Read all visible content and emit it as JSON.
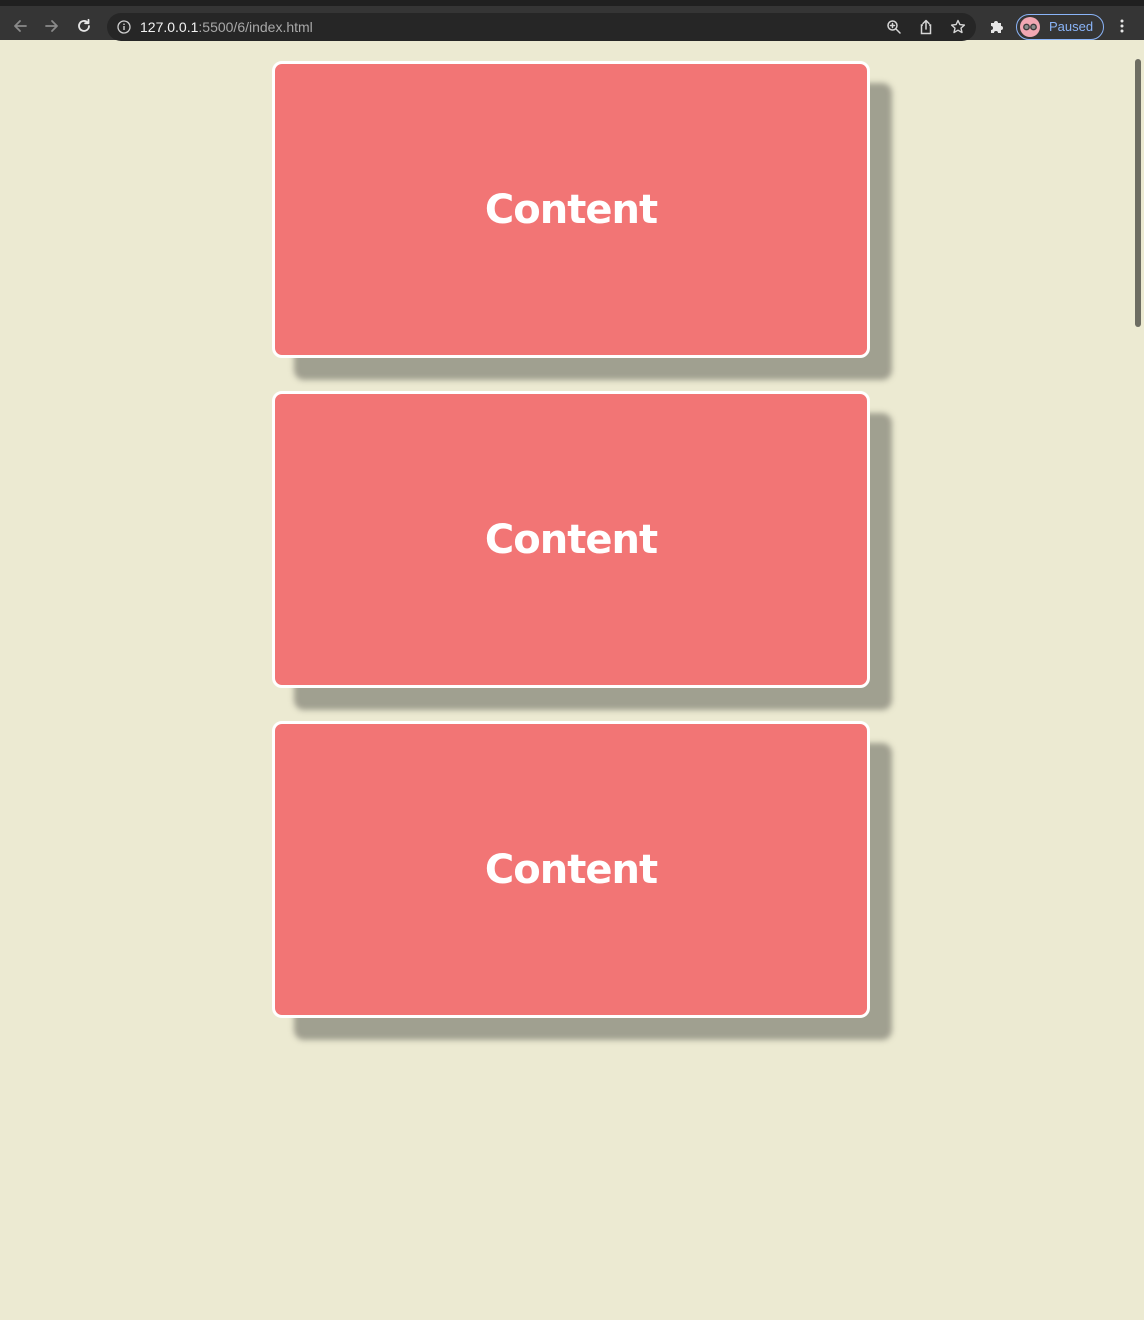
{
  "browser": {
    "url_host": "127.0.0.1",
    "url_path": ":5500/6/index.html",
    "profile_status": "Paused",
    "icons": {
      "back": "arrow-left-icon",
      "forward": "arrow-right-icon",
      "reload": "reload-icon",
      "site_info": "info-icon",
      "zoom": "zoom-icon",
      "share": "share-icon",
      "bookmark": "star-icon",
      "extensions": "puzzle-icon",
      "menu": "kebab-menu-icon"
    }
  },
  "page": {
    "background_color": "#ecead2",
    "cards": [
      {
        "label": "Content"
      },
      {
        "label": "Content"
      },
      {
        "label": "Content"
      }
    ]
  },
  "colors": {
    "card_fill": "#f27575",
    "card_border": "#ffffff",
    "profile_accent": "#8ab4f8"
  }
}
